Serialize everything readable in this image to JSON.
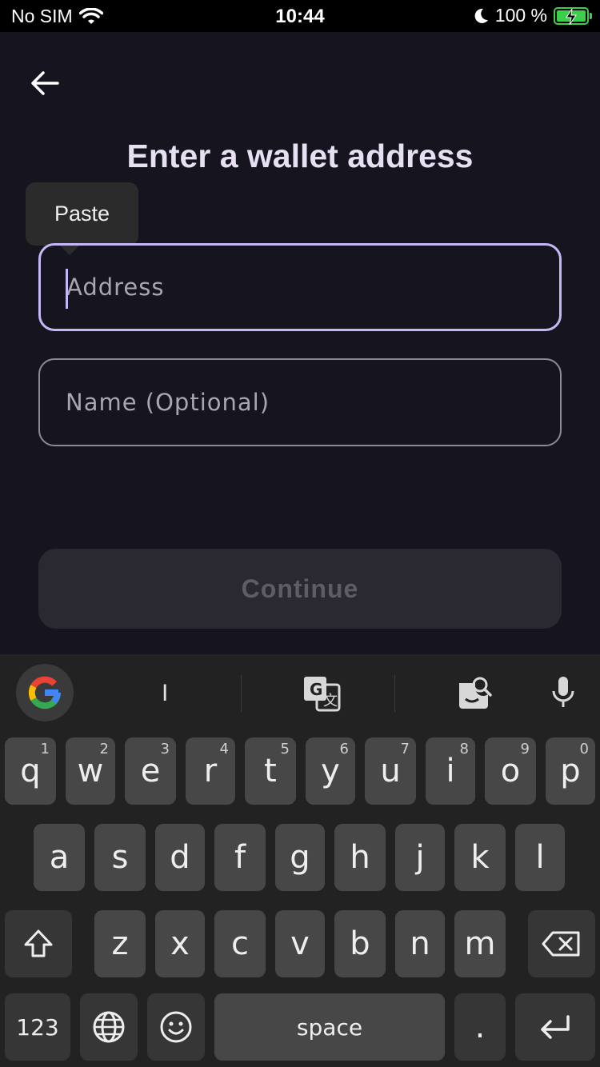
{
  "status_bar": {
    "carrier": "No SIM",
    "time": "10:44",
    "battery_percent": "100 %",
    "battery_level": 1.0
  },
  "header": {
    "back_icon": "arrow-left-icon",
    "title": "Enter a wallet address"
  },
  "tooltip": {
    "label": "Paste"
  },
  "form": {
    "address_placeholder": "Address",
    "name_placeholder": "Name (Optional)",
    "continue_label": "Continue"
  },
  "colors": {
    "background": "#16141f",
    "focus_border": "#c6b7f6",
    "title": "#e6e0f2"
  },
  "keyboard": {
    "suggestion": "I",
    "row1": [
      {
        "key": "q",
        "num": "1"
      },
      {
        "key": "w",
        "num": "2"
      },
      {
        "key": "e",
        "num": "3"
      },
      {
        "key": "r",
        "num": "4"
      },
      {
        "key": "t",
        "num": "5"
      },
      {
        "key": "y",
        "num": "6"
      },
      {
        "key": "u",
        "num": "7"
      },
      {
        "key": "i",
        "num": "8"
      },
      {
        "key": "o",
        "num": "9"
      },
      {
        "key": "p",
        "num": "0"
      }
    ],
    "row2": [
      "a",
      "s",
      "d",
      "f",
      "g",
      "h",
      "j",
      "k",
      "l"
    ],
    "row3": [
      "z",
      "x",
      "c",
      "v",
      "b",
      "n",
      "m"
    ],
    "bottom": {
      "numbers": "123",
      "space": "space",
      "period": "."
    }
  }
}
